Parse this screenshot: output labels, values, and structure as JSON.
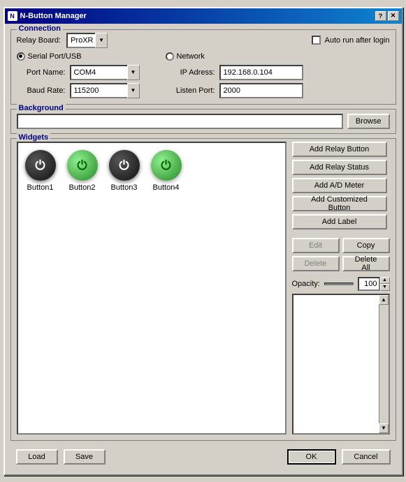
{
  "window": {
    "title": "N-Button Manager",
    "icon_label": "N"
  },
  "title_buttons": {
    "help": "?",
    "close": "✕"
  },
  "connection": {
    "group_label": "Connection",
    "relay_board_label": "Relay Board:",
    "relay_board_value": "ProXR",
    "relay_board_options": [
      "ProXR"
    ],
    "auto_run_label": "Auto run after login",
    "serial_label": "Serial Port/USB",
    "network_label": "Network",
    "port_name_label": "Port Name:",
    "port_name_value": "COM4",
    "port_name_options": [
      "COM4"
    ],
    "baud_rate_label": "Baud Rate:",
    "baud_rate_value": "115200",
    "baud_rate_options": [
      "115200"
    ],
    "ip_address_label": "IP Adress:",
    "ip_address_value": "192.168.0.104",
    "listen_port_label": "Listen Port:",
    "listen_port_value": "2000"
  },
  "background": {
    "group_label": "Background",
    "browse_label": "Browse"
  },
  "widgets": {
    "group_label": "Widgets",
    "items": [
      {
        "label": "Button1",
        "style": "dark"
      },
      {
        "label": "Button2",
        "style": "green"
      },
      {
        "label": "Button3",
        "style": "dark"
      },
      {
        "label": "Button4",
        "style": "green"
      }
    ],
    "buttons": {
      "add_relay_button": "Add Relay Button",
      "add_relay_status": "Add Relay Status",
      "add_ad_meter": "Add A/D Meter",
      "add_customized_button": "Add Customized Button",
      "add_label": "Add Label"
    },
    "actions": {
      "edit": "Edit",
      "copy": "Copy",
      "delete": "Delete",
      "delete_all": "Delete All"
    },
    "opacity_label": "Opacity:",
    "opacity_value": "100"
  },
  "bottom": {
    "load": "Load",
    "save": "Save",
    "ok": "OK",
    "cancel": "Cancel"
  }
}
